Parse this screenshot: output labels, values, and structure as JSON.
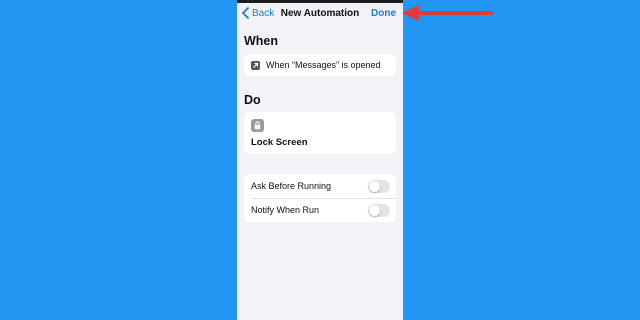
{
  "nav": {
    "back_label": "Back",
    "title": "New Automation",
    "done_label": "Done"
  },
  "when": {
    "heading": "When",
    "trigger_text": "When “Messages” is opened",
    "trigger_icon": "arrow-up-right-icon"
  },
  "do": {
    "heading": "Do",
    "action_label": "Lock Screen",
    "action_icon": "lock-icon"
  },
  "options": [
    {
      "label": "Ask Before Running",
      "enabled": false
    },
    {
      "label": "Notify When Run",
      "enabled": false
    }
  ],
  "colors": {
    "background": "#2196f3",
    "accent": "#1e7bd6",
    "annotation_arrow": "#e53935"
  }
}
